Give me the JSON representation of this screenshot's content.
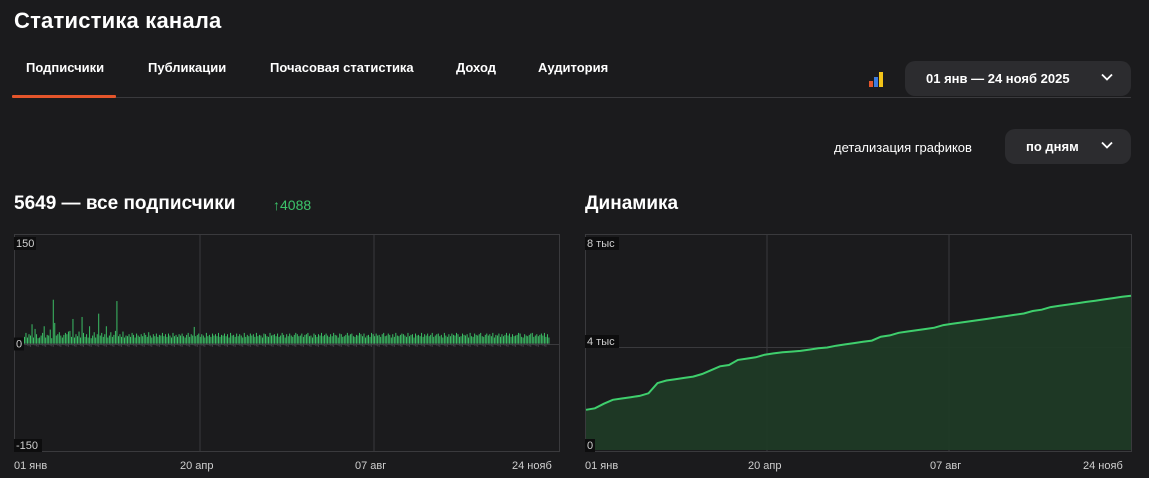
{
  "page_title": "Статистика канала",
  "tabs": [
    {
      "label": "Подписчики",
      "active": true
    },
    {
      "label": "Публикации"
    },
    {
      "label": "Почасовая статистика"
    },
    {
      "label": "Доход"
    },
    {
      "label": "Аудитория"
    }
  ],
  "date_range": "01 янв — 24 нояб 2025",
  "detail": {
    "label": "детализация графиков",
    "value": "по дням"
  },
  "subscribers": {
    "heading": "5649 — все подписчики",
    "delta": "4088"
  },
  "dynamics": {
    "heading": "Динамика"
  },
  "colors": {
    "accent": "#e4552b",
    "positive": "#3cc46a",
    "background": "#1b1b1d",
    "pill": "#2c2c2f"
  },
  "chart_data": [
    {
      "type": "bar",
      "ylim": [
        -150,
        150
      ],
      "yticks": [
        "150",
        "0",
        "-150"
      ],
      "xticks": [
        "01 янв",
        "20 апр",
        "07 авг",
        "24 нояб"
      ],
      "series": [
        {
          "values": [
            10,
            16,
            9,
            14,
            12,
            29,
            9,
            22,
            14,
            8,
            9,
            12,
            16,
            26,
            9,
            13,
            12,
            21,
            8,
            66,
            31,
            12,
            14,
            17,
            12,
            9,
            13,
            16,
            14,
            18,
            19,
            10,
            37,
            9,
            14,
            11,
            18,
            9,
            40,
            16,
            10,
            14,
            9,
            26,
            8,
            12,
            17,
            9,
            14,
            45,
            12,
            16,
            10,
            14,
            26,
            9,
            12,
            17,
            10,
            13,
            19,
            64,
            11,
            14,
            10,
            18,
            9,
            12,
            11,
            14,
            10,
            16,
            13,
            9,
            15,
            12,
            10,
            14,
            11,
            16,
            13,
            10,
            17,
            12,
            9,
            14,
            11,
            15,
            10,
            13,
            12,
            16,
            11,
            14,
            10,
            15,
            12,
            9,
            16,
            11,
            13,
            10,
            14,
            12,
            15,
            11,
            9,
            13,
            16,
            10,
            14,
            12,
            25,
            11,
            13,
            15,
            10,
            14,
            12,
            9,
            16,
            11,
            13,
            10,
            15,
            12,
            14,
            11,
            16,
            10,
            13,
            12,
            15,
            11,
            14,
            9,
            16,
            12,
            13,
            10,
            15,
            11,
            14,
            12,
            9,
            16,
            10,
            13,
            11,
            15,
            12,
            14,
            10,
            16,
            11,
            13,
            12,
            9,
            15,
            14,
            11,
            10,
            16,
            12,
            13,
            14,
            11,
            15,
            10,
            12,
            16,
            13,
            9,
            14,
            11,
            15,
            12,
            10,
            13,
            16,
            14,
            11,
            12,
            15,
            10,
            13,
            14,
            16,
            11,
            12,
            9,
            15,
            13,
            10,
            14,
            12,
            16,
            11,
            13,
            15,
            12,
            10,
            14,
            11,
            16,
            13,
            12,
            9,
            15,
            14,
            10,
            11,
            13,
            16,
            12,
            14,
            15,
            11,
            10,
            13,
            12,
            16,
            14,
            11,
            15,
            9,
            12,
            13,
            10,
            16,
            14,
            11,
            15,
            12,
            13,
            10,
            14,
            16,
            11,
            12,
            15,
            13,
            9,
            14,
            10,
            16,
            12,
            11,
            13,
            15,
            14,
            12,
            10,
            16,
            11,
            13,
            14,
            9,
            15,
            12,
            13,
            11,
            16,
            10,
            14,
            12,
            15,
            11,
            13,
            16,
            10,
            12,
            14,
            15,
            11,
            13,
            9,
            16,
            12,
            10,
            14,
            11,
            15,
            13,
            12,
            16,
            14,
            10,
            11,
            15,
            13,
            12,
            14,
            9,
            16,
            11,
            10,
            15,
            13,
            12,
            14,
            16,
            11,
            10,
            13,
            15,
            12,
            14,
            11,
            16,
            9,
            13,
            12,
            15,
            10,
            14,
            11,
            13,
            16,
            12,
            15,
            10,
            14,
            11,
            12,
            13,
            16,
            15,
            10,
            9,
            14,
            12,
            11,
            13,
            15,
            16,
            10,
            12,
            14,
            11,
            13,
            15,
            12,
            16,
            10,
            14,
            9
          ]
        }
      ]
    },
    {
      "type": "area",
      "ylim": [
        0,
        8000
      ],
      "yticks": [
        "8 тыс",
        "4 тыс",
        "0"
      ],
      "xticks": [
        "01 янв",
        "20 апр",
        "07 авг",
        "24 нояб"
      ],
      "series": [
        {
          "values": [
            1561,
            1620,
            1800,
            1950,
            2000,
            2050,
            2100,
            2200,
            2600,
            2700,
            2750,
            2800,
            2850,
            2950,
            3100,
            3250,
            3300,
            3500,
            3550,
            3600,
            3700,
            3750,
            3800,
            3820,
            3850,
            3900,
            3950,
            3980,
            4050,
            4100,
            4150,
            4200,
            4250,
            4400,
            4450,
            4550,
            4600,
            4650,
            4700,
            4750,
            4850,
            4900,
            4950,
            5000,
            5050,
            5100,
            5150,
            5200,
            5250,
            5300,
            5400,
            5450,
            5550,
            5600,
            5650,
            5700,
            5750,
            5800,
            5850,
            5900,
            5950,
            5990
          ]
        }
      ]
    }
  ]
}
